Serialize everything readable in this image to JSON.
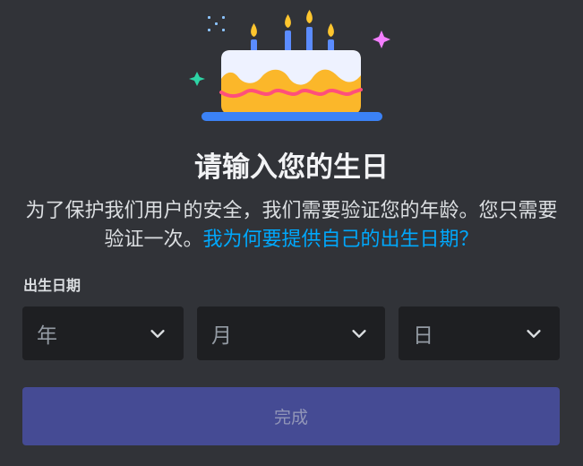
{
  "dialog": {
    "title": "请输入您的生日",
    "subtitle_text": "为了保护我们用户的安全，我们需要验证您的年龄。您只需要验证一次。",
    "why_link": "我为何要提供自己的出生日期？",
    "illustration": "birthday-cake"
  },
  "birthday": {
    "label": "出生日期",
    "year": {
      "placeholder": "年",
      "icon": "chevron-down-icon"
    },
    "month": {
      "placeholder": "月",
      "icon": "chevron-down-icon"
    },
    "day": {
      "placeholder": "日",
      "icon": "chevron-down-icon"
    }
  },
  "actions": {
    "done_label": "完成",
    "done_enabled": false
  },
  "colors": {
    "background": "#313338",
    "input_background": "#1e1f22",
    "link": "#00a8fc",
    "button": "#454b94",
    "cake_base": "#fbb72a",
    "plate": "#3b82f6"
  }
}
